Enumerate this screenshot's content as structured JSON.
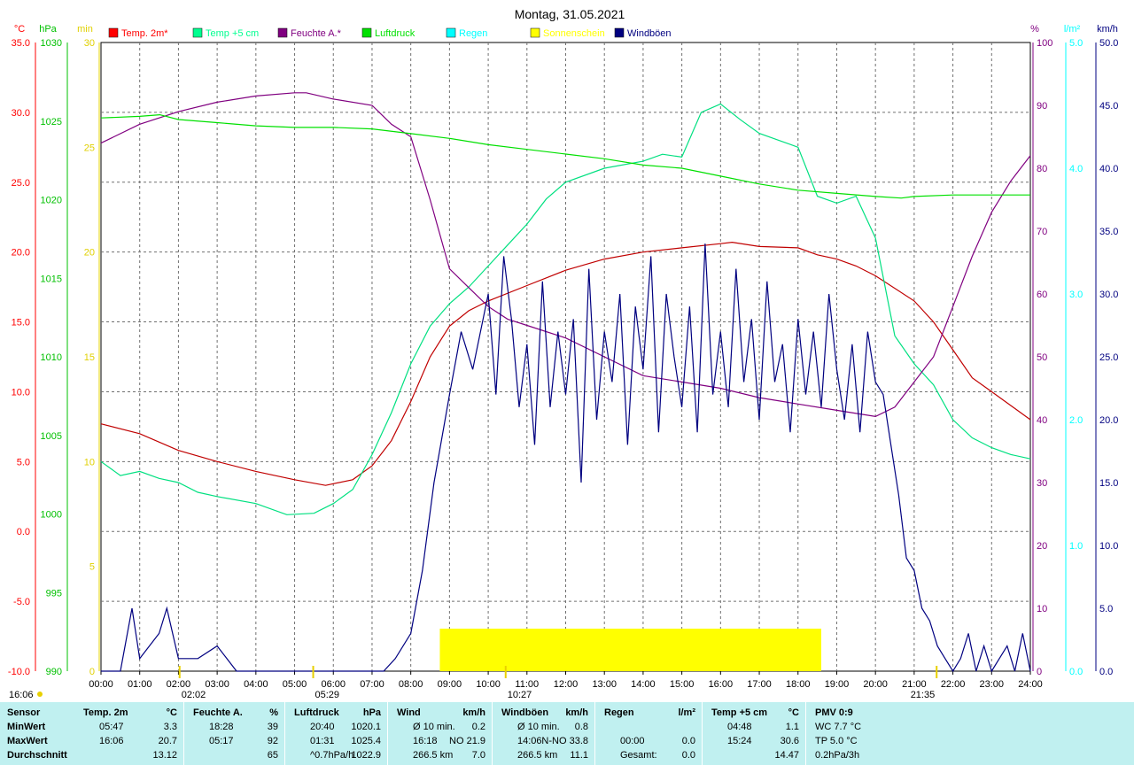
{
  "chart_data": {
    "type": "line",
    "title": "Montag, 31.05.2021",
    "x_ticks": [
      "00:00",
      "01:00",
      "02:00",
      "03:00",
      "04:00",
      "05:00",
      "06:00",
      "07:00",
      "08:00",
      "09:00",
      "10:00",
      "11:00",
      "12:00",
      "13:00",
      "14:00",
      "15:00",
      "16:00",
      "17:00",
      "18:00",
      "19:00",
      "20:00",
      "21:00",
      "22:00",
      "23:00",
      "24:00"
    ],
    "axes": {
      "temp": {
        "unit": "°C",
        "range": [
          -10,
          35
        ],
        "ticks": [
          "35.0",
          "30.0",
          "25.0",
          "20.0",
          "15.0",
          "10.0",
          "5.0",
          "0.0",
          "-5.0",
          "-10.0"
        ],
        "color": "#ff0000"
      },
      "pressure": {
        "unit": "hPa",
        "range": [
          990,
          1030
        ],
        "ticks": [
          "1030",
          "1025",
          "1020",
          "1015",
          "1010",
          "1005",
          "1000",
          "995",
          "990"
        ],
        "color": "#00c000"
      },
      "sunshine": {
        "unit": "min",
        "range": [
          0,
          30
        ],
        "ticks": [
          "30",
          "25",
          "20",
          "15",
          "10",
          "5",
          "0"
        ],
        "color": "#e0d000"
      },
      "humidity": {
        "unit": "%",
        "range": [
          0,
          100
        ],
        "ticks": [
          "100",
          "90",
          "80",
          "70",
          "60",
          "50",
          "40",
          "30",
          "20",
          "10",
          "0"
        ],
        "color": "#800080"
      },
      "rain": {
        "unit": "l/m²",
        "range": [
          0,
          5
        ],
        "ticks": [
          "5.0",
          "4.0",
          "3.0",
          "2.0",
          "1.0",
          "0.0"
        ],
        "color": "#00ffff"
      },
      "wind": {
        "unit": "km/h",
        "range": [
          0,
          50
        ],
        "ticks": [
          "50.0",
          "45.0",
          "40.0",
          "35.0",
          "30.0",
          "25.0",
          "20.0",
          "15.0",
          "10.0",
          "5.0",
          "0.0"
        ],
        "color": "#000080"
      }
    },
    "legend": [
      {
        "name": "Temp. 2m*",
        "color": "#ff0000"
      },
      {
        "name": "Temp +5 cm",
        "color": "#00ff90"
      },
      {
        "name": "Feuchte A.*",
        "color": "#800080"
      },
      {
        "name": "Luftdruck",
        "color": "#00e000"
      },
      {
        "name": "Regen",
        "color": "#00ffff"
      },
      {
        "name": "Sonnenschein",
        "color": "#ffff00"
      },
      {
        "name": "Windböen",
        "color": "#000080"
      }
    ],
    "series": [
      {
        "name": "Temp. 2m*",
        "axis": "temp",
        "color": "#c00000",
        "x": [
          0,
          1,
          2,
          3,
          4,
          5,
          5.8,
          6.5,
          7,
          7.5,
          8,
          8.5,
          9,
          9.5,
          10,
          11,
          12,
          13,
          14,
          15,
          16,
          16.3,
          17,
          18,
          18.5,
          19,
          19.5,
          20,
          21,
          21.5,
          22,
          22.5,
          23,
          24
        ],
        "y": [
          7.7,
          7.0,
          5.8,
          5.0,
          4.3,
          3.7,
          3.3,
          3.7,
          4.7,
          6.5,
          9.3,
          12.5,
          14.7,
          15.8,
          16.5,
          17.6,
          18.7,
          19.5,
          20.0,
          20.3,
          20.6,
          20.7,
          20.4,
          20.3,
          19.8,
          19.5,
          19.0,
          18.3,
          16.5,
          15.0,
          13.0,
          11.0,
          10.0,
          8.0
        ]
      },
      {
        "name": "Temp +5 cm",
        "axis": "temp",
        "color": "#00e080",
        "x": [
          0,
          0.5,
          1,
          1.5,
          2,
          2.5,
          3,
          4,
          4.8,
          5.5,
          6,
          6.5,
          7,
          7.5,
          8,
          8.5,
          9,
          9.5,
          10,
          10.5,
          11,
          11.5,
          12,
          13,
          14,
          14.5,
          15,
          15.5,
          16,
          16.5,
          17,
          17.5,
          18,
          18.5,
          19,
          19.5,
          20,
          20.5,
          21,
          21.5,
          22,
          22.5,
          23,
          23.5,
          24
        ],
        "y": [
          5.0,
          4.0,
          4.3,
          3.8,
          3.5,
          2.8,
          2.5,
          2.0,
          1.2,
          1.3,
          2.0,
          3.0,
          5.5,
          8.5,
          12.0,
          14.7,
          16.3,
          17.5,
          19.0,
          20.5,
          22.0,
          23.8,
          25.0,
          26.0,
          26.5,
          27.0,
          26.8,
          30.0,
          30.6,
          29.5,
          28.5,
          28.0,
          27.5,
          24.0,
          23.5,
          24.0,
          21.0,
          14.0,
          12.0,
          10.5,
          8.0,
          6.7,
          6.0,
          5.5,
          5.2
        ]
      },
      {
        "name": "Feuchte A.*",
        "axis": "humidity",
        "color": "#800080",
        "x": [
          0,
          1,
          2,
          3,
          4,
          5,
          5.3,
          6,
          7,
          7.5,
          8,
          8.5,
          9,
          9.5,
          10,
          10.5,
          11,
          12,
          13,
          14,
          15,
          16,
          17,
          18,
          19,
          19.5,
          20,
          20.5,
          21,
          21.5,
          22,
          22.5,
          23,
          23.5,
          24
        ],
        "y": [
          84.0,
          87.0,
          89.0,
          90.5,
          91.5,
          92.0,
          92.0,
          91.0,
          90.0,
          87.0,
          85.0,
          75.0,
          64.0,
          61.0,
          58.0,
          56.0,
          55.0,
          53.0,
          50.0,
          47.0,
          46.0,
          45.0,
          43.5,
          42.5,
          41.5,
          41.0,
          40.5,
          42.0,
          46.0,
          50.0,
          58.0,
          66.0,
          73.0,
          78.0,
          82.0
        ]
      },
      {
        "name": "Luftdruck",
        "axis": "pressure",
        "color": "#00e000",
        "x": [
          0,
          1,
          1.52,
          2,
          3,
          4,
          5,
          6,
          7,
          8,
          9,
          10,
          11,
          12,
          13,
          14,
          15,
          16,
          17,
          18,
          19,
          20,
          20.67,
          21,
          22,
          23,
          24
        ],
        "y": [
          1025.2,
          1025.3,
          1025.4,
          1025.1,
          1024.9,
          1024.7,
          1024.6,
          1024.6,
          1024.5,
          1024.2,
          1023.9,
          1023.5,
          1023.2,
          1022.9,
          1022.6,
          1022.2,
          1022.0,
          1021.5,
          1021.0,
          1020.6,
          1020.4,
          1020.2,
          1020.1,
          1020.2,
          1020.3,
          1020.3,
          1020.3
        ]
      },
      {
        "name": "Windböen",
        "axis": "wind",
        "color": "#000080",
        "x": [
          0,
          0.5,
          0.8,
          1,
          1.5,
          1.7,
          2,
          2.5,
          3,
          3.5,
          4,
          4.5,
          5,
          5.5,
          6,
          6.5,
          7,
          7.3,
          7.6,
          8,
          8.3,
          8.6,
          9,
          9.3,
          9.6,
          10,
          10.2,
          10.4,
          10.6,
          10.8,
          11,
          11.2,
          11.4,
          11.6,
          11.8,
          12,
          12.2,
          12.4,
          12.6,
          12.8,
          13,
          13.2,
          13.4,
          13.6,
          13.8,
          14,
          14.2,
          14.4,
          14.6,
          14.8,
          15,
          15.2,
          15.4,
          15.6,
          15.8,
          16,
          16.2,
          16.4,
          16.6,
          16.8,
          17,
          17.2,
          17.4,
          17.6,
          17.8,
          18,
          18.2,
          18.4,
          18.6,
          18.8,
          19,
          19.2,
          19.4,
          19.6,
          19.8,
          20,
          20.2,
          20.4,
          20.6,
          20.8,
          21,
          21.2,
          21.4,
          21.6,
          21.8,
          22,
          22.2,
          22.4,
          22.6,
          22.8,
          23,
          23.2,
          23.4,
          23.6,
          23.8,
          24
        ],
        "y": [
          0,
          0,
          5,
          1,
          3,
          5,
          1,
          1,
          2,
          0,
          0,
          0,
          0,
          0,
          0,
          0,
          0,
          0,
          1,
          3,
          8,
          15,
          22,
          27,
          24,
          30,
          22,
          33,
          28,
          21,
          26,
          18,
          31,
          21,
          27,
          22,
          28,
          15,
          32,
          20,
          27,
          23,
          30,
          18,
          29,
          24,
          33,
          19,
          30,
          25,
          21,
          29,
          19,
          34,
          22,
          27,
          21,
          32,
          23,
          28,
          20,
          31,
          23,
          26,
          19,
          28,
          22,
          27,
          21,
          30,
          24,
          20,
          26,
          19,
          27,
          23,
          22,
          18,
          14,
          9,
          8,
          5,
          4,
          2,
          1,
          0,
          1,
          3,
          0,
          2,
          0,
          1,
          2,
          0,
          3,
          0
        ]
      },
      {
        "name": "Sonnenschein",
        "axis": "sunshine",
        "color": "#ffff00",
        "x": [
          8.75,
          18.6
        ],
        "y": [
          2,
          2
        ]
      }
    ],
    "markers": [
      {
        "label": "16:06",
        "axis": "bottom-left"
      },
      {
        "label": "02:02",
        "x": 2.03
      },
      {
        "label": "05:29",
        "x": 5.48
      },
      {
        "label": "10:27",
        "x": 10.45
      },
      {
        "label": "21:35",
        "x": 21.58
      }
    ]
  },
  "stats": {
    "row_labels": [
      "Sensor",
      "MinWert",
      "MaxWert",
      "Durchschnitt"
    ],
    "blocks": [
      {
        "name": "Temp. 2m",
        "unit": "°C",
        "rows": [
          [
            "05:47",
            "3.3"
          ],
          [
            "16:06",
            "20.7"
          ],
          [
            "",
            "13.12"
          ]
        ]
      },
      {
        "name": "Feuchte A.",
        "unit": "%",
        "rows": [
          [
            "18:28",
            "39"
          ],
          [
            "05:17",
            "92"
          ],
          [
            "",
            "65"
          ]
        ]
      },
      {
        "name": "Luftdruck",
        "unit": "hPa",
        "rows": [
          [
            "20:40",
            "1020.1"
          ],
          [
            "01:31",
            "1025.4"
          ],
          [
            "^0.7hPa/h",
            "1022.9"
          ]
        ]
      },
      {
        "name": "Wind",
        "unit": "km/h",
        "rows": [
          [
            "Ø 10 min.",
            "0.2"
          ],
          [
            "16:18",
            "NO 21.9"
          ],
          [
            "266.5 km",
            "7.0"
          ]
        ]
      },
      {
        "name": "Windböen",
        "unit": "km/h",
        "rows": [
          [
            "Ø 10 min.",
            "0.8"
          ],
          [
            "14:06",
            "N-NO 33.8"
          ],
          [
            "266.5 km",
            "11.1"
          ]
        ]
      },
      {
        "name": "Regen",
        "unit": "l/m²",
        "rows": [
          [
            "",
            ""
          ],
          [
            "00:00",
            "0.0"
          ],
          [
            "Gesamt:",
            "0.0"
          ]
        ]
      },
      {
        "name": "Temp +5 cm",
        "unit": "°C",
        "rows": [
          [
            "04:48",
            "1.1"
          ],
          [
            "15:24",
            "30.6"
          ],
          [
            "",
            "14.47"
          ]
        ]
      },
      {
        "name": "PMV 0:9",
        "unit": "",
        "rows": [
          [
            "WC 7.7 °C",
            ""
          ],
          [
            "TP 5.0 °C",
            ""
          ],
          [
            "0.2hPa/3h",
            ""
          ]
        ]
      }
    ]
  }
}
